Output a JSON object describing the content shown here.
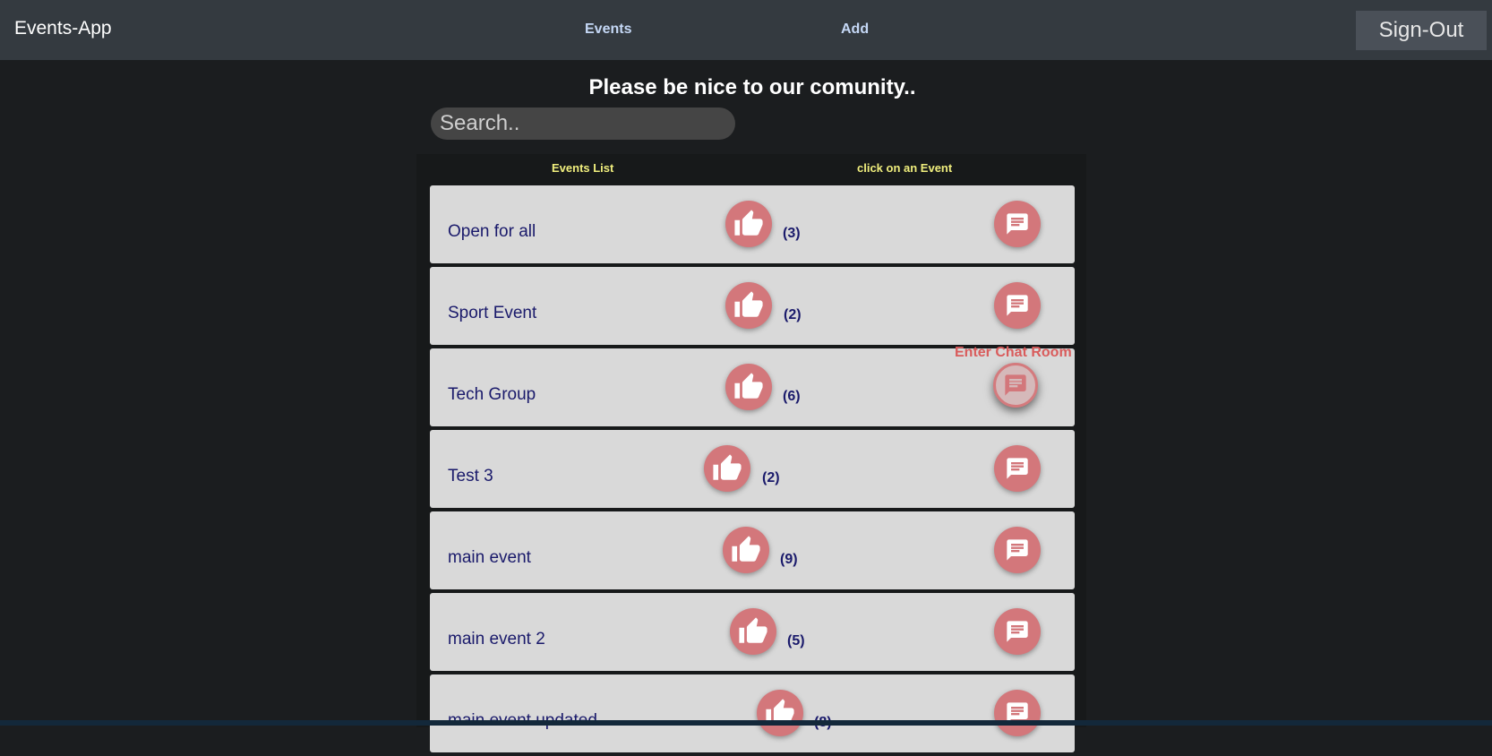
{
  "navbar": {
    "brand": "Events-App",
    "links": [
      "Events",
      "Add"
    ],
    "signout_label": "Sign-Out"
  },
  "heading": "Please be nice to our comunity..",
  "search": {
    "placeholder": "Search..",
    "value": ""
  },
  "columns": {
    "left": "Events List",
    "right": "click on an Event"
  },
  "tooltip": "Enter Chat Room",
  "colors": {
    "navbar": "#343a40",
    "background": "#1b1d1f",
    "button": "#d3777b",
    "column_title": "#f0ee7d",
    "event_text": "#1a1a6b",
    "tooltip": "#d95c5c"
  },
  "icons": {
    "like": "thumb-up-icon",
    "chat": "chat-icon"
  },
  "events": [
    {
      "title": "Open for all",
      "likes": "(3)"
    },
    {
      "title": "Sport Event",
      "likes": "(2)"
    },
    {
      "title": "Tech Group",
      "likes": "(6)"
    },
    {
      "title": "Test 3",
      "likes": "(2)"
    },
    {
      "title": "main event",
      "likes": "(9)"
    },
    {
      "title": "main event 2",
      "likes": "(5)"
    },
    {
      "title": "main event updated",
      "likes": "(8)"
    }
  ]
}
